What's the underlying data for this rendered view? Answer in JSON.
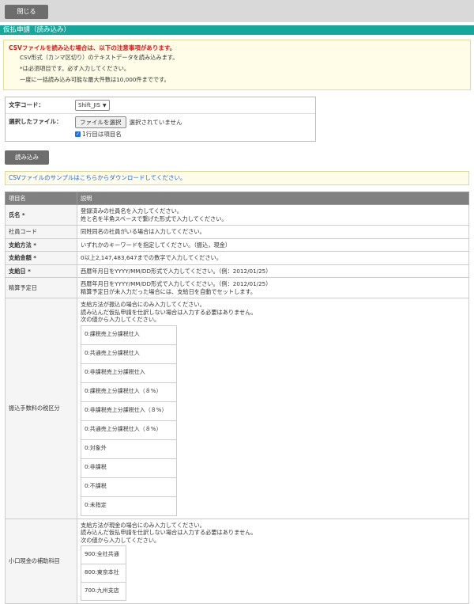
{
  "toolbar": {
    "close_label": "閉じる"
  },
  "title": "仮払申請（読み込み）",
  "notice": {
    "warning": "CSVファイルを読み込む場合は、以下の注意事項があります。",
    "lines": [
      "CSV形式（カンマ区切り）のテキストデータを読み込みます。",
      "*は必須項目です。必ず入力してください。",
      "一度に一括読み込み可能な最大件数は10,000件までです。"
    ]
  },
  "form": {
    "encoding_label": "文字コード：",
    "encoding_value": "Shift_JIS",
    "file_label": "選択したファイル：",
    "file_button": "ファイルを選択",
    "file_status": "選択されていません",
    "header_checkbox_label": "1行目は項目名"
  },
  "load_button": "読み込み",
  "sample_link": "CSVファイルのサンプルはこちらからダウンロードしてください。",
  "table": {
    "headers": [
      "項目名",
      "説明"
    ],
    "rows": [
      {
        "name": "氏名 *",
        "desc": [
          "登録済みの社員名を入力してください。",
          "姓と名を半角スペースで繋げた形式で入力してください。"
        ]
      },
      {
        "name": "社員コード",
        "desc": [
          "同姓同名の社員がいる場合は入力してください。"
        ]
      },
      {
        "name": "支給方法 *",
        "desc": [
          "いずれかのキーワードを指定してください。（振込，現金）"
        ]
      },
      {
        "name": "支給金額 *",
        "desc": [
          "0以上2,147,483,647までの数字で入力してください。"
        ]
      },
      {
        "name": "支給日 *",
        "desc": [
          "西暦年月日をYYYY/MM/DD形式で入力してください。（例：2012/01/25）"
        ]
      },
      {
        "name": "精算予定日",
        "desc": [
          "西暦年月日をYYYY/MM/DD形式で入力してください。（例：2012/01/25）",
          "精算予定日が未入力だった場合には、支給日を自動でセットします。"
        ]
      },
      {
        "name": "振込手数料の税区分",
        "desc": [
          "支給方法が振込の場合にのみ入力してください。",
          "読み込んだ仮払申請を仕訳しない場合は入力する必要はありません。",
          "次の値から入力してください。"
        ],
        "options": [
          "0:課税売上分課税仕入",
          "0:共通売上分課税仕入",
          "0:非課税売上分課税仕入",
          "0:課税売上分課税仕入（８%）",
          "0:非課税売上分課税仕入（８%）",
          "0:共通売上分課税仕入（８%）",
          "0:対象外",
          "0:非課税",
          "0:不課税",
          "0:未指定"
        ]
      },
      {
        "name": "小口現金の補助科目",
        "desc": [
          "支給方法が現金の場合にのみ入力してください。",
          "読み込んだ仮払申請を仕訳しない場合は入力する必要はありません。",
          "次の値から入力してください。"
        ],
        "options": [
          "900:全社共通",
          "800:東京本社",
          "700:九州支店"
        ]
      }
    ]
  }
}
